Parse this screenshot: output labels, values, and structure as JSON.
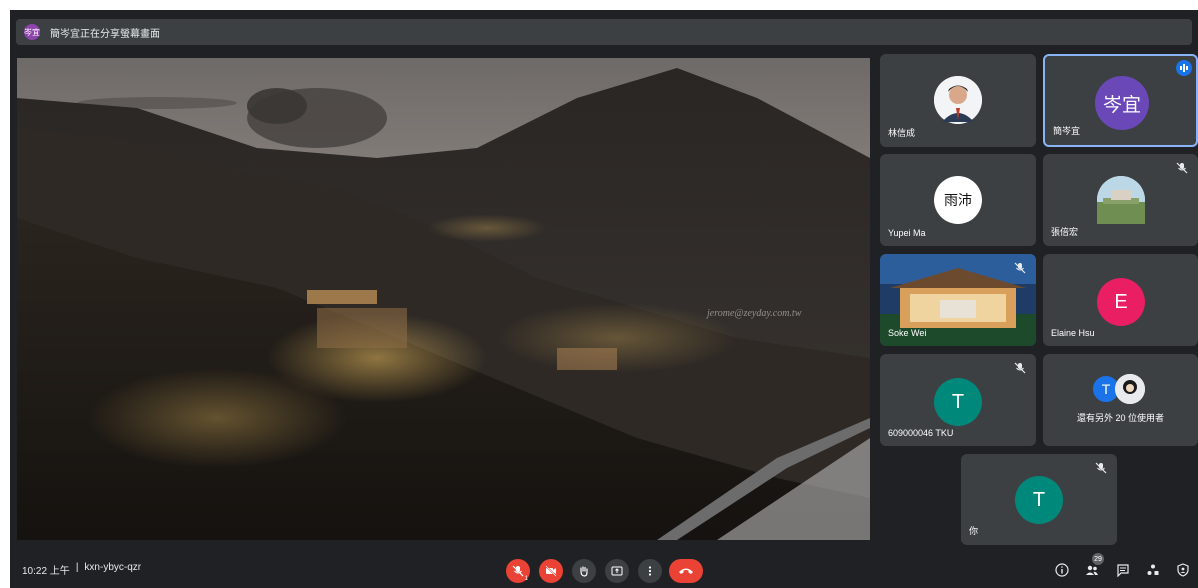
{
  "banner": {
    "avatar_text": "岑宜",
    "text": "簡岑宜正在分享螢幕畫面"
  },
  "presentation": {
    "watermark": "jerome@zeyday.com.tw"
  },
  "participants": [
    {
      "name": "林信成",
      "avatar_type": "photo",
      "muted": false
    },
    {
      "name": "簡岑宜",
      "avatar_text": "岑宜",
      "avatar_color": "#6b48b8",
      "speaking": true,
      "muted": false
    },
    {
      "name": "Yupei Ma",
      "avatar_text": "雨沛",
      "avatar_color": "#ffffff",
      "muted": false
    },
    {
      "name": "張倍宏",
      "avatar_type": "photo",
      "muted": true
    },
    {
      "name": "Soke Wei",
      "avatar_type": "video",
      "muted": true
    },
    {
      "name": "Elaine Hsu",
      "avatar_text": "E",
      "avatar_color": "#e91e63",
      "muted": false
    },
    {
      "name": "609000046 TKU",
      "avatar_text": "T",
      "avatar_color": "#00897b",
      "muted": true
    },
    {
      "name": "還有另外 20 位使用者",
      "avatar_text": "T",
      "avatar_color": "#1a73e8",
      "muted": false
    },
    {
      "name": "你",
      "avatar_text": "T",
      "avatar_color": "#00897b",
      "muted": true
    }
  ],
  "bottom": {
    "time": "10:22 上午",
    "separator": "|",
    "meeting_code": "kxn-ybyc-qzr",
    "mic_badge": "1",
    "people_count": "29"
  },
  "colors": {
    "background": "#202124",
    "tile": "#3c4043",
    "danger": "#ea4335",
    "accent": "#8ab4f8"
  }
}
